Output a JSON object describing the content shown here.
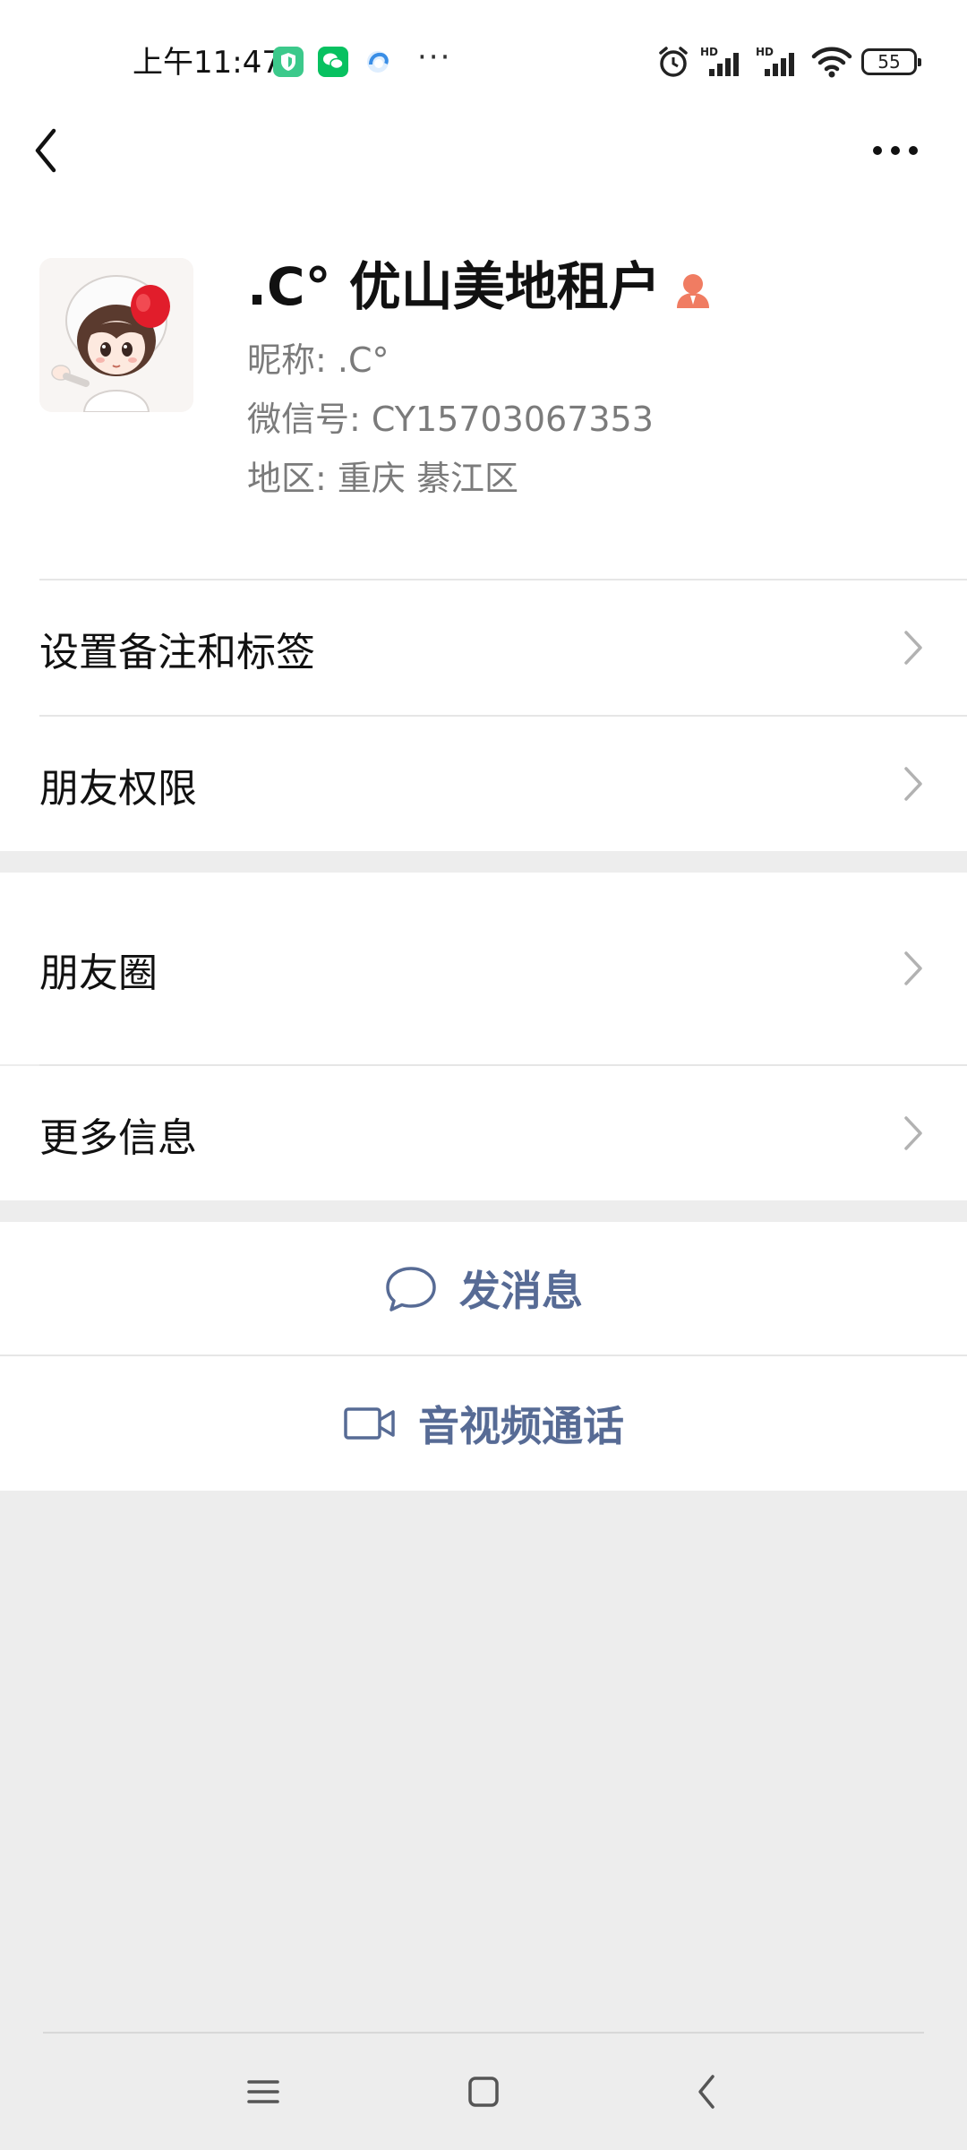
{
  "status_bar": {
    "time": "上午11:47",
    "app_icons": [
      "shield-app-icon",
      "wechat-icon",
      "browser-app-icon"
    ],
    "more_dots": "···",
    "signal_1_label": "HD",
    "signal_2_label": "HD",
    "battery": "55"
  },
  "nav": {
    "back_icon": "chevron-left-icon",
    "more_icon": "more-horizontal-icon"
  },
  "profile": {
    "display_name": ".C° 优山美地租户",
    "nickname": "昵称:  .C°",
    "wechat_id": "微信号:  CY15703067353",
    "region": "地区:  重庆  綦江区"
  },
  "menu_group_1": {
    "items": [
      {
        "label": "设置备注和标签"
      },
      {
        "label": "朋友权限"
      }
    ]
  },
  "menu_group_2": {
    "items": [
      {
        "label": "朋友圈"
      },
      {
        "label": "更多信息"
      }
    ]
  },
  "actions": {
    "message_label": "发消息",
    "call_label": "音视频通话"
  },
  "colors": {
    "link": "#576b95",
    "background": "#ededed",
    "badge": "#f07c62",
    "wechat_green": "#07c160"
  }
}
